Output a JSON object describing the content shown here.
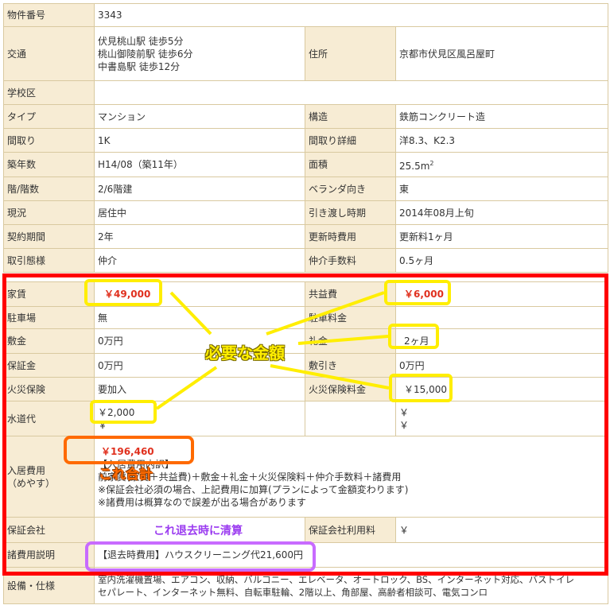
{
  "rows": {
    "bukken": {
      "th": "物件番号",
      "val": "3343"
    },
    "kotsu": {
      "th": "交通",
      "lines": [
        "伏見桃山駅 徒歩5分",
        "桃山御陵前駅 徒歩6分",
        "中書島駅 徒歩12分"
      ],
      "th2": "住所",
      "val2": "京都市伏見区風呂屋町"
    },
    "gakku": {
      "th": "学校区",
      "val": ""
    },
    "type": {
      "th": "タイプ",
      "val": "マンション",
      "th2": "構造",
      "val2": "鉄筋コンクリート造"
    },
    "madori": {
      "th": "間取り",
      "val": "1K",
      "th2": "間取り詳細",
      "val2": "洋8.3、K2.3"
    },
    "chiku": {
      "th": "築年数",
      "val": "H14/08（築11年）",
      "th2": "面積",
      "val2": "25.5m",
      "sup": "2"
    },
    "kai": {
      "th": "階/階数",
      "val": "2/6階建",
      "th2": "ベランダ向き",
      "val2": "東"
    },
    "genkyo": {
      "th": "現況",
      "val": "居住中",
      "th2": "引き渡し時期",
      "val2": "2014年08月上旬"
    },
    "keiyaku": {
      "th": "契約期間",
      "val": "2年",
      "th2": "更新時費用",
      "val2": "更新料1ヶ月"
    },
    "torihiki": {
      "th": "取引態様",
      "val": "仲介",
      "th2": "仲介手数料",
      "val2": "0.5ヶ月"
    },
    "yachin": {
      "th": "家賃",
      "val": "￥49,000",
      "th2": "共益費",
      "val2": "￥6,000"
    },
    "chusha": {
      "th": "駐車場",
      "val": "無",
      "th2": "駐車料金",
      "val2": ""
    },
    "shikikin": {
      "th": "敷金",
      "val": "0万円",
      "th2": "礼金",
      "val2": "2ヶ月"
    },
    "hosho": {
      "th": "保証金",
      "val": "0万円",
      "th2": "敷引き",
      "val2": "0万円"
    },
    "kasai": {
      "th": "火災保険",
      "val": "要加入",
      "th2": "火災保険料金",
      "val2": "￥15,000"
    },
    "suido": {
      "th": "水道代",
      "val": "￥2,000",
      "val_b": "￥",
      "th2": "",
      "val2": "￥",
      "val2_b": "￥"
    },
    "nyukyo": {
      "th": "入居費用",
      "th_sub": "（めやす）",
      "price": "￥196,460",
      "breakdown_title": "【入居費用内訳】",
      "lines": [
        "前家賃(家賃＋共益費)＋敷金＋礼金＋火災保険料＋仲介手数料＋諸費用",
        "※保証会社必須の場合、上記費用に加算(プランによって金額変わります)",
        "※諸費用は概算なので誤差が出る場合があります"
      ]
    },
    "hoshokaisha": {
      "th": "保証会社",
      "val": "",
      "th2": "保証会社利用料",
      "val2": "￥"
    },
    "shohiyo": {
      "th": "諸費用説明",
      "val": "【退去時費用】ハウスクリーニング代21,600円"
    },
    "setsubi": {
      "th": "設備・仕様",
      "lines": [
        "室内洗濯機置場、エアコン、収納、バルコニー、エレベータ、オートロック、BS、インターネット対応、バストイレ",
        "セパレート、インターネット無料、自転車駐輪、2階以上、角部屋、高齢者相談可、電気コンロ"
      ]
    }
  },
  "annotations": {
    "need": "必要な金額",
    "total": "これ合計",
    "move_out": "これ退去時に清算"
  }
}
